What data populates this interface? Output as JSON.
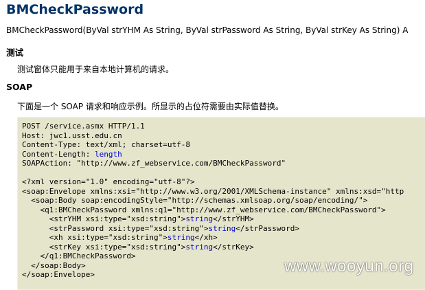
{
  "operation": {
    "title": "BMCheckPassword",
    "signature": "BMCheckPassword(ByVal strYHM As String, ByVal strPassword As String, ByVal strKey As String) A"
  },
  "test_section": {
    "heading": "测试",
    "text": "测试窗体只能用于来自本地计算机的请求。"
  },
  "soap_section": {
    "heading": "SOAP",
    "text": "下面是一个 SOAP 请求和响应示例。所显示的占位符需要由实际值替换。",
    "http_lines": [
      "POST /service.asmx HTTP/1.1",
      "Host: jwc1.usst.edu.cn",
      "Content-Type: text/xml; charset=utf-8"
    ],
    "content_length_prefix": "Content-Length: ",
    "content_length_placeholder": "length",
    "soap_action": "SOAPAction: \"http://www.zf_webservice.com/BMCheckPassword\"",
    "xml_decl": "<?xml version=\"1.0\" encoding=\"utf-8\"?>",
    "envelope_open": "<soap:Envelope xmlns:xsi=\"http://www.w3.org/2001/XMLSchema-instance\" xmlns:xsd=\"http",
    "body_open": "  <soap:Body soap:encodingStyle=\"http://schemas.xmlsoap.org/soap/encoding/\">",
    "q1_open": "    <q1:BMCheckPassword xmlns:q1=\"http://www.zf_webservice.com/BMCheckPassword\">",
    "params": [
      {
        "open": "      <strYHM xsi:type=\"xsd:string\">",
        "placeholder": "string",
        "close": "</strYHM>"
      },
      {
        "open": "      <strPassword xsi:type=\"xsd:string\">",
        "placeholder": "string",
        "close": "</strPassword>"
      },
      {
        "open": "      <xh xsi:type=\"xsd:string\">",
        "placeholder": "string",
        "close": "</xh>"
      },
      {
        "open": "      <strKey xsi:type=\"xsd:string\">",
        "placeholder": "string",
        "close": "</strKey>"
      }
    ],
    "q1_close": "    </q1:BMCheckPassword>",
    "body_close": "  </soap:Body>",
    "envelope_close": "</soap:Envelope>"
  },
  "watermark": "www.wooyun.org",
  "colors": {
    "title": "#003366",
    "code_background": "#e5e5cc",
    "placeholder": "#0000cc"
  }
}
